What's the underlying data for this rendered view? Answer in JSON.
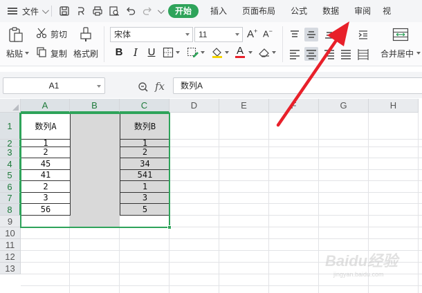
{
  "menubar": {
    "file_label": "文件",
    "tabs": [
      {
        "label": "开始",
        "active": true
      },
      {
        "label": "插入",
        "active": false
      },
      {
        "label": "页面布局",
        "active": false
      },
      {
        "label": "公式",
        "active": false
      },
      {
        "label": "数据",
        "active": false
      },
      {
        "label": "审阅",
        "active": false
      },
      {
        "label": "视",
        "active": false
      }
    ]
  },
  "ribbon": {
    "paste_label": "粘贴",
    "cut_label": "剪切",
    "copy_label": "复制",
    "format_painter_label": "格式刷",
    "font_name": "宋体",
    "font_size": "11",
    "merge_label": "合并居中"
  },
  "formula_bar": {
    "cell_ref": "A1",
    "fx_label": "fx",
    "formula_value": "数列A"
  },
  "sheet": {
    "columns": [
      "A",
      "B",
      "C",
      "D",
      "E",
      "F",
      "G",
      "H"
    ],
    "rows": [
      "1",
      "2",
      "3",
      "4",
      "5",
      "6",
      "7",
      "8",
      "9",
      "10",
      "11",
      "12",
      "13"
    ],
    "header_a": "数列A",
    "header_c": "数列B",
    "col_a": [
      "1",
      "2",
      "45",
      "41",
      "2",
      "3",
      "56"
    ],
    "col_c": [
      "1",
      "2",
      "34",
      "541",
      "1",
      "3",
      "5"
    ]
  },
  "colors": {
    "accent": "#2ea35a",
    "annotation_arrow": "#e8202a",
    "gray_fill": "#d9d9d9"
  },
  "watermark": {
    "logo_text": "Baidu经验",
    "url_text": "jingyan.baidu.com"
  }
}
